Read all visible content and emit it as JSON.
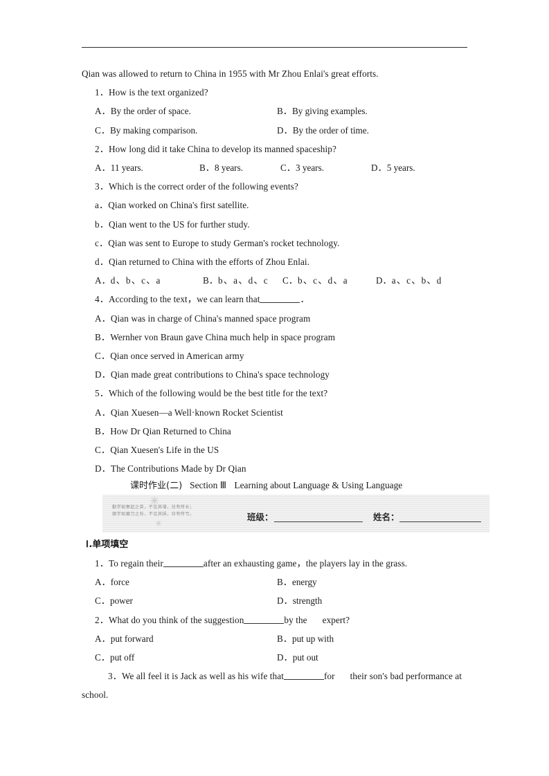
{
  "document": {
    "top_rule": true,
    "intro_line": "Qian was allowed to return to China in 1955 with Mr Zhou Enlai's great efforts."
  },
  "reading_questions": [
    {
      "number": "1．",
      "stem": "How is the text organized?",
      "layout": "two-column",
      "options": [
        {
          "label": "A．",
          "text": "By the order of space."
        },
        {
          "label": "B．",
          "text": "By giving examples."
        },
        {
          "label": "C．",
          "text": "By making comparison."
        },
        {
          "label": "D．",
          "text": "By the order of time."
        }
      ]
    },
    {
      "number": "2．",
      "stem": "How long did it take China to develop its manned spaceship?",
      "layout": "four-column",
      "options": [
        {
          "label": "A．",
          "text": "11 years."
        },
        {
          "label": "B．",
          "text": "8 years."
        },
        {
          "label": "C．",
          "text": "3 years."
        },
        {
          "label": "D．",
          "text": "5 years."
        }
      ]
    },
    {
      "number": "3．",
      "stem": "Which is the correct order of the following events?",
      "layout": "ordering",
      "events": [
        {
          "label": "a．",
          "text": "Qian worked on China's first satellite."
        },
        {
          "label": "b．",
          "text": "Qian went to the US for further study."
        },
        {
          "label": "c．",
          "text": "Qian was sent to Europe to study German's rocket technology."
        },
        {
          "label": "d．",
          "text": "Qian returned to China with the efforts of Zhou Enlai."
        }
      ],
      "options": [
        {
          "label": "A．",
          "text": "d、b、c、a"
        },
        {
          "label": "B．",
          "text": "b、a、d、c"
        },
        {
          "label": "C．",
          "text": "b、c、d、a"
        },
        {
          "label": "D．",
          "text": "a、c、b、d"
        }
      ]
    },
    {
      "number": "4．",
      "stem_before": "According to the text，we can learn that",
      "stem_after": "．",
      "layout": "one-column",
      "options": [
        {
          "label": "A．",
          "text": "Qian was in charge of China's manned space program"
        },
        {
          "label": "B．",
          "text": "Wernher von Braun gave China much help in space program"
        },
        {
          "label": "C．",
          "text": "Qian once served in American army"
        },
        {
          "label": "D．",
          "text": "Qian made great contributions to China's space technology"
        }
      ]
    },
    {
      "number": "5．",
      "stem": "Which of the following would be the best title for the text?",
      "layout": "one-column",
      "options": [
        {
          "label": "A．",
          "text": "Qian Xuesen—a Well·known Rocket Scientist"
        },
        {
          "label": "B．",
          "text": "How Dr Qian Returned to China"
        },
        {
          "label": "C．",
          "text": "Qian Xuesen's Life in the US"
        },
        {
          "label": "D．",
          "text": "The Contributions Made by Dr Qian"
        }
      ]
    }
  ],
  "section_title": {
    "homework": "课时作业(二)",
    "section": "Section",
    "section_numeral": "Ⅲ",
    "topic": "Learning about Language & Using Language"
  },
  "banner": {
    "motto_line1": "勤学如春起之苗，不见其增，日有所长；",
    "motto_line2": "辍学如磨刀之石，不见其损，日有所亏。",
    "class_label": "班级：",
    "name_label": "姓名："
  },
  "part_heading": {
    "numeral": "Ⅰ",
    "text": ".单项填空"
  },
  "exercises": [
    {
      "number": "1．",
      "stem_before": "To regain their",
      "stem_after": "after an exhausting game，the players lay in the grass.",
      "layout": "two-column",
      "options": [
        {
          "label": "A．",
          "text": "force"
        },
        {
          "label": "B．",
          "text": "energy"
        },
        {
          "label": "C．",
          "text": "power"
        },
        {
          "label": "D．",
          "text": "strength"
        }
      ]
    },
    {
      "number": "2．",
      "stem_before": "What do you think of the suggestion",
      "stem_after": "by the",
      "stem_tail": "expert?",
      "layout": "two-column",
      "options": [
        {
          "label": "A．",
          "text": "put forward"
        },
        {
          "label": "B．",
          "text": "put up with"
        },
        {
          "label": "C．",
          "text": "put off"
        },
        {
          "label": "D．",
          "text": "put out"
        }
      ]
    },
    {
      "number": "3．",
      "stem_before": "We all feel it is Jack as well as his wife that",
      "stem_after": "for",
      "stem_tail": "their son's bad performance at school."
    }
  ]
}
